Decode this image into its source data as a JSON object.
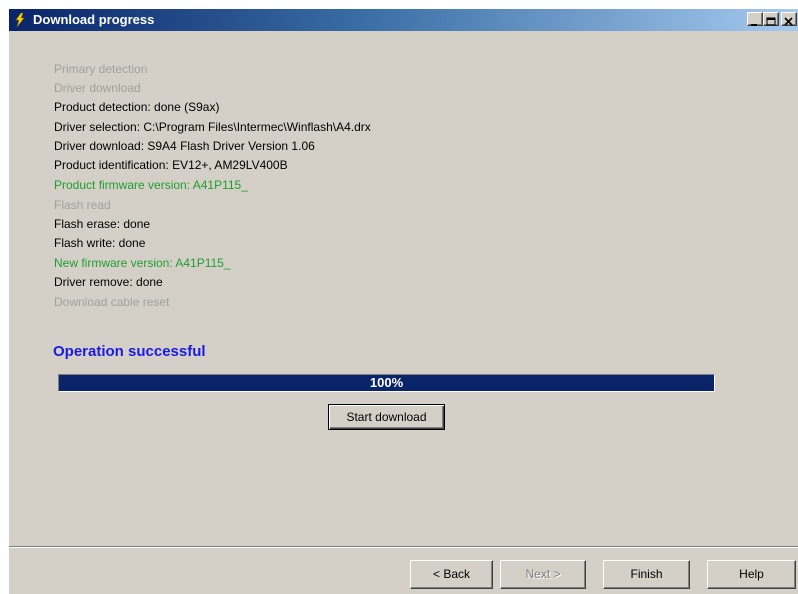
{
  "window": {
    "title": "Download progress"
  },
  "log": [
    {
      "text": "Primary detection",
      "color": "#a0a0a0"
    },
    {
      "text": "Driver download",
      "color": "#a0a0a0"
    },
    {
      "text": "Product detection: done (S9ax)",
      "color": "#000000"
    },
    {
      "text": "Driver selection: C:\\Program Files\\Intermec\\Winflash\\A4.drx",
      "color": "#000000"
    },
    {
      "text": "Driver download: S9A4 Flash Driver Version 1.06",
      "color": "#000000"
    },
    {
      "text": "Product identification: EV12+, AM29LV400B",
      "color": "#000000"
    },
    {
      "text": "Product firmware version: A41P115_",
      "color": "#1f9f2f"
    },
    {
      "text": "Flash read",
      "color": "#a0a0a0"
    },
    {
      "text": "Flash erase: done",
      "color": "#000000"
    },
    {
      "text": "Flash write: done",
      "color": "#000000"
    },
    {
      "text": "New firmware version: A41P115_",
      "color": "#1f9f2f"
    },
    {
      "text": "Driver remove: done",
      "color": "#000000"
    },
    {
      "text": "Download cable reset",
      "color": "#a0a0a0"
    }
  ],
  "status": {
    "text": "Operation successful",
    "color": "#1a1ae6"
  },
  "progress": {
    "value": 100,
    "label": "100%"
  },
  "start_download_label": "Start download",
  "nav": {
    "back_label": "< Back",
    "next_label": "Next >",
    "finish_label": "Finish",
    "help_label": "Help"
  }
}
